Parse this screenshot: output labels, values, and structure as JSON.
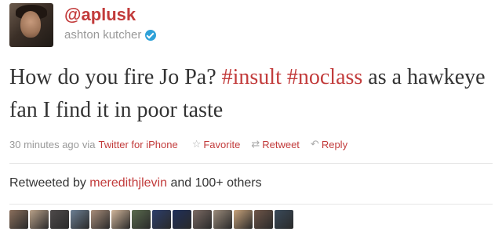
{
  "user": {
    "handle": "@aplusk",
    "real_name": "ashton kutcher",
    "verified": true
  },
  "tweet": {
    "segments": [
      {
        "text": "How do you fire Jo Pa? ",
        "kind": "text"
      },
      {
        "text": "#insult",
        "kind": "hashtag"
      },
      {
        "text": " ",
        "kind": "text"
      },
      {
        "text": "#noclass",
        "kind": "hashtag"
      },
      {
        "text": " as a hawkeye fan I find it in poor taste",
        "kind": "text"
      }
    ]
  },
  "meta": {
    "time": "30 minutes ago",
    "via": "via",
    "source": "Twitter for iPhone"
  },
  "actions": {
    "favorite": "Favorite",
    "retweet": "Retweet",
    "reply": "Reply"
  },
  "retweets": {
    "prefix": "Retweeted by",
    "user": "meredithjlevin",
    "suffix": "and 100+ others"
  },
  "retweeter_avatars": [
    {
      "color": "#8a6f5c"
    },
    {
      "color": "#b9a189"
    },
    {
      "color": "#4e4a4a"
    },
    {
      "color": "#6c7f93"
    },
    {
      "color": "#a88d7a"
    },
    {
      "color": "#d1b59a"
    },
    {
      "color": "#5a6b4e"
    },
    {
      "color": "#2c3e6b"
    },
    {
      "color": "#1f2f5a"
    },
    {
      "color": "#7b6a63"
    },
    {
      "color": "#9a8a7a"
    },
    {
      "color": "#c7a27a"
    },
    {
      "color": "#6e5548"
    },
    {
      "color": "#3a4a5a"
    }
  ],
  "colors": {
    "accent": "#c23b3b",
    "muted": "#999999",
    "verified": "#2ea1d8"
  }
}
